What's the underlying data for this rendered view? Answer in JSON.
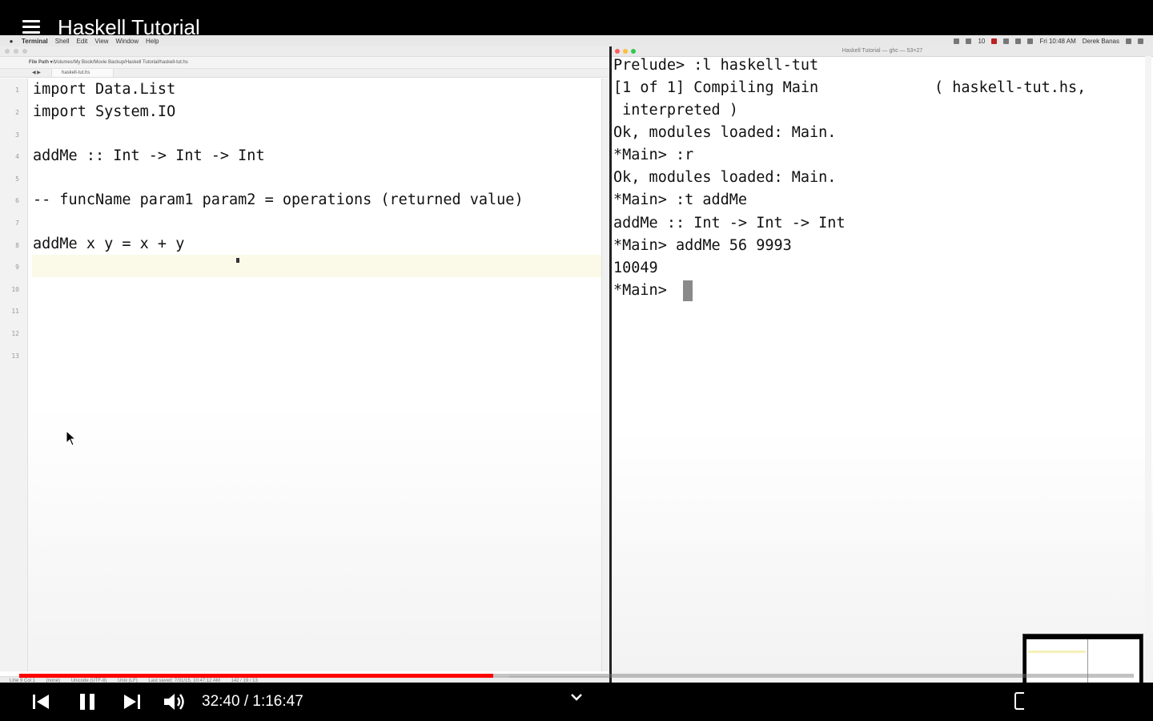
{
  "video": {
    "title": "Haskell Tutorial",
    "time_display": "32:40 / 1:16:47",
    "progress": 0.425,
    "buffered": 0.44
  },
  "menubar": {
    "app": "Terminal",
    "items": [
      "Shell",
      "Edit",
      "View",
      "Window",
      "Help"
    ],
    "battery": "10",
    "clock": "Fri 10:48 AM",
    "user": "Derek Banas"
  },
  "editor": {
    "filepath_label": "File Path ▾ :",
    "filepath": "/Volumes/My Book/Movie Backup/Haskell Tutorial/haskell-tut.hs",
    "tab": "haskell-tut.hs",
    "line_numbers": [
      "1",
      "2",
      "3",
      "4",
      "5",
      "6",
      "7",
      "8",
      "9",
      "10",
      "11",
      "12",
      "13"
    ],
    "lines": [
      "import Data.List",
      "import System.IO",
      "",
      "addMe :: Int -> Int -> Int",
      "",
      "-- funcName param1 param2 = operations (returned value)",
      "",
      "addMe x y = x + y",
      ""
    ],
    "status": {
      "position": "Line 9 Col 1",
      "mode": "(none)",
      "encoding": "Unicode (UTF-8)",
      "line_endings": "Unix (LF)",
      "saved": "Last saved: 7/31/15, 10:47:12 AM",
      "counts": "142 / 19 / 13"
    }
  },
  "terminal": {
    "title": "Haskell Tutorial — ghc — 53×27",
    "lines": [
      "Prelude> :l haskell-tut",
      "[1 of 1] Compiling Main             ( haskell-tut.hs,",
      " interpreted )",
      "Ok, modules loaded: Main.",
      "*Main> :r",
      "Ok, modules loaded: Main.",
      "*Main> :t addMe",
      "addMe :: Int -> Int -> Int",
      "*Main> addMe 56 9993",
      "10049",
      "*Main> "
    ]
  },
  "colors": {
    "progress": "#ff0000",
    "current_line": "#fbf9e8"
  },
  "icons": {
    "menu": "hamburger-icon",
    "prev": "skip-previous-icon",
    "pause": "pause-icon",
    "next": "skip-next-icon",
    "volume": "volume-icon",
    "expand": "chevron-down-icon"
  }
}
